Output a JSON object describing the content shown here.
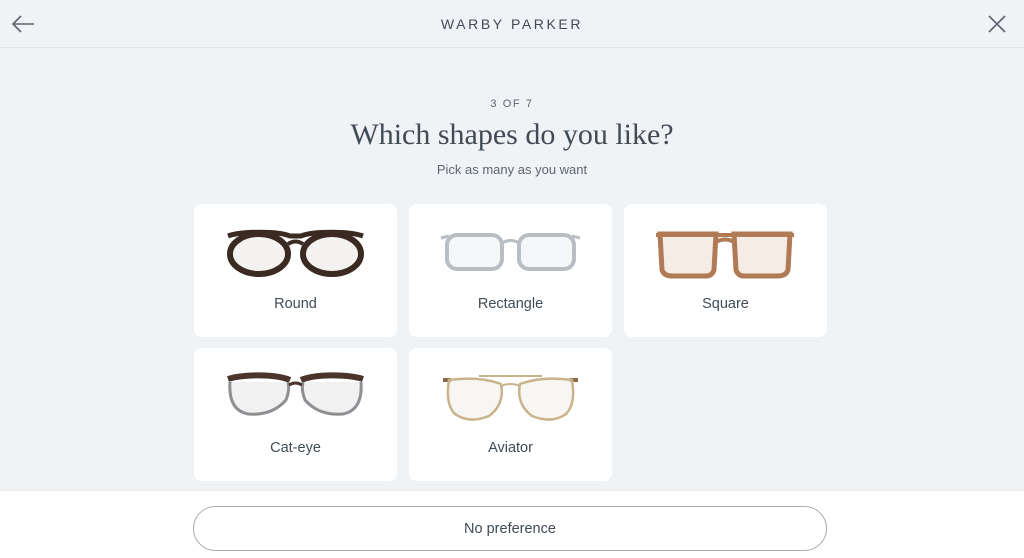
{
  "header": {
    "brand": "WARBY PARKER",
    "back_icon": "arrow-left-icon",
    "close_icon": "close-icon"
  },
  "quiz": {
    "step": "3 OF 7",
    "title": "Which shapes do you like?",
    "subtitle": "Pick as many as you want"
  },
  "shapes": [
    {
      "label": "Round",
      "icon": "round-glasses-icon",
      "color": "#3a2a22"
    },
    {
      "label": "Rectangle",
      "icon": "rectangle-glasses-icon",
      "color": "#b9bec4"
    },
    {
      "label": "Square",
      "icon": "square-glasses-icon",
      "color": "#b07a54"
    },
    {
      "label": "Cat-eye",
      "icon": "cat-eye-glasses-icon",
      "color": "#4a342b"
    },
    {
      "label": "Aviator",
      "icon": "aviator-glasses-icon",
      "color": "#c9b38a"
    }
  ],
  "footer": {
    "no_preference": "No preference"
  }
}
